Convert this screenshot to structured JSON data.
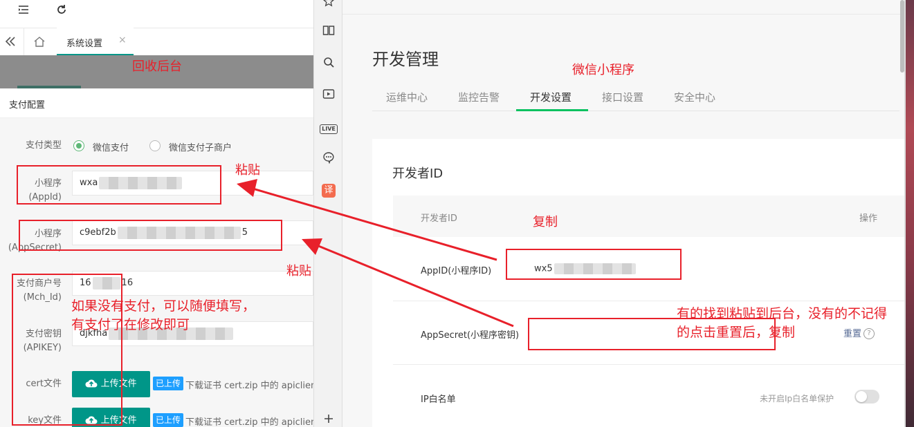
{
  "left_panel": {
    "tab_label": "系统设置",
    "tab_close": "×",
    "section_title": "支付配置",
    "pay_type": {
      "label": "支付类型",
      "options": [
        "微信支付",
        "微信支付子商户"
      ],
      "selected": "微信支付"
    },
    "appid": {
      "label_1": "小程序",
      "label_2": "(AppId)",
      "value": "wxa"
    },
    "appsecret": {
      "label_1": "小程序",
      "label_2": "(AppSecret)",
      "value_start": "c9ebf2b",
      "value_end": "5"
    },
    "mch_id": {
      "label_1": "支付商户号",
      "label_2": "(Mch_Id)",
      "value_start": "16",
      "value_end": "16"
    },
    "apikey": {
      "label_1": "支付密钥",
      "label_2": "(APIKEY)",
      "value": "djkfha"
    },
    "cert": {
      "label": "cert文件",
      "button": "上传文件",
      "badge": "已上传",
      "hint": "下载证书 cert.zip 中的 apiclient"
    },
    "key": {
      "label": "key文件",
      "button": "上传文件",
      "badge": "已上传",
      "hint": "下载证书 cert.zip 中的 apiclient"
    }
  },
  "right_panel": {
    "title": "开发管理",
    "tabs": [
      {
        "label": "运维中心"
      },
      {
        "label": "监控告警"
      },
      {
        "label": "开发设置"
      },
      {
        "label": "接口设置"
      },
      {
        "label": "安全中心"
      }
    ],
    "active_tab": "开发设置",
    "card_title": "开发者ID",
    "table_header": {
      "col1": "开发者ID",
      "col2": "操作"
    },
    "rows": {
      "appid": {
        "label": "AppID(小程序ID)",
        "value": "wx5"
      },
      "appsecret": {
        "label": "AppSecret(小程序密钥)",
        "action": "重置"
      },
      "ip": {
        "label": "IP白名单",
        "hint": "未开启Ip白名单保护"
      }
    }
  },
  "annotations": {
    "recycle_backend": "回收后台",
    "wechat_mini": "微信小程序",
    "paste_1": "粘贴",
    "paste_2": "粘贴",
    "copy": "复制",
    "no_pay_line1": "如果没有支付，可以随便填写，",
    "no_pay_line2": "有支付了在修改即可",
    "reset_line1": "有的找到粘贴到后台，没有的不记得",
    "reset_line2": "的点击重置后，复制"
  },
  "colors": {
    "annotation_red": "#e8202a",
    "wechat_green": "#07c160",
    "layui_green": "#009688",
    "badge_blue": "#1e9fff",
    "link_blue": "#576b95"
  },
  "icons": [
    "menu-fold-icon",
    "refresh-icon",
    "double-chevron-left-icon",
    "home-icon",
    "star-icon",
    "book-icon",
    "search-icon",
    "video-icon",
    "live-icon",
    "chat-icon",
    "translate-icon",
    "plus-icon",
    "cloud-upload-icon",
    "question-icon"
  ]
}
